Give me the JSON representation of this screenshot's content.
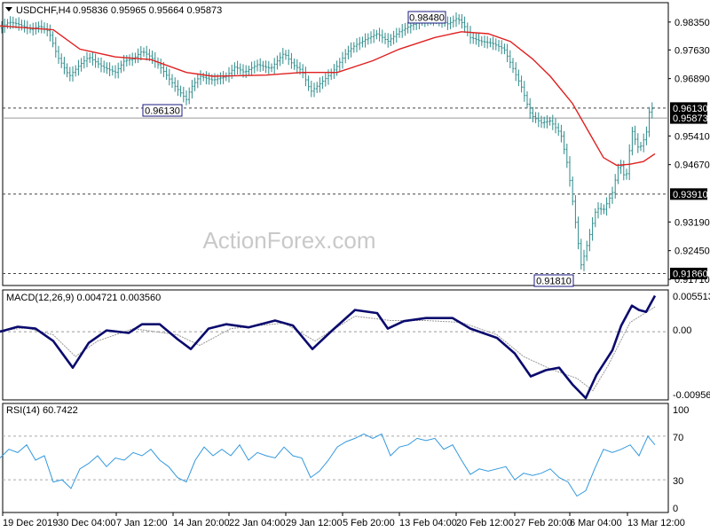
{
  "header": {
    "symbol": "USDCHF,H4",
    "ohlc": "0.95836 0.95965 0.95664 0.95873"
  },
  "watermark": "ActionForex.com",
  "price_panel": {
    "y_ticks": [
      "0.98350",
      "0.97630",
      "0.96890",
      "0.96130",
      "0.95873",
      "0.95410",
      "0.94670",
      "0.93910",
      "0.93190",
      "0.92450",
      "0.91860",
      "0.91710"
    ],
    "badge_ticks": [
      "0.96130",
      "0.95873",
      "0.93910",
      "0.91860"
    ],
    "callouts": [
      "0.98480",
      "0.96130",
      "0.91810"
    ]
  },
  "macd_panel": {
    "title": "MACD(12,26,9) 0.004721 0.003560",
    "y_ticks": [
      "0.005513",
      "0.00",
      "-0.009566"
    ]
  },
  "rsi_panel": {
    "title": "RSI(14) 60.7422",
    "y_ticks": [
      "100",
      "70",
      "30",
      "0"
    ]
  },
  "x_ticks": [
    "19 Dec 2019",
    "30 Dec 04:00",
    "7 Jan 12:00",
    "14 Jan 20:00",
    "22 Jan 04:00",
    "29 Jan 12:00",
    "5 Feb 20:00",
    "13 Feb 04:00",
    "20 Feb 12:00",
    "27 Feb 20:00",
    "6 Mar 04:00",
    "13 Mar 12:00"
  ],
  "colors": {
    "bars": "#2e8b8b",
    "ma": "#e02020",
    "macd": "#0a0a6e",
    "signal": "#999999",
    "rsi": "#3399dd",
    "badge": "#000000",
    "callout_border": "#1a1a80"
  },
  "chart_data": [
    {
      "type": "ohlc",
      "ylim": [
        0.9155,
        0.9885
      ],
      "horizontal_levels": [
        0.9613,
        0.95873,
        0.9391,
        0.9186
      ],
      "close_path": [
        [
          0,
          0.982
        ],
        [
          10,
          0.9835
        ],
        [
          20,
          0.983
        ],
        [
          35,
          0.9815
        ],
        [
          45,
          0.9825
        ],
        [
          55,
          0.981
        ],
        [
          65,
          0.9745
        ],
        [
          78,
          0.9695
        ],
        [
          90,
          0.9725
        ],
        [
          100,
          0.9745
        ],
        [
          115,
          0.972
        ],
        [
          130,
          0.9705
        ],
        [
          140,
          0.9735
        ],
        [
          150,
          0.974
        ],
        [
          160,
          0.976
        ],
        [
          170,
          0.9745
        ],
        [
          182,
          0.9715
        ],
        [
          195,
          0.9675
        ],
        [
          210,
          0.9635
        ],
        [
          215,
          0.9665
        ],
        [
          225,
          0.9695
        ],
        [
          240,
          0.9685
        ],
        [
          255,
          0.9695
        ],
        [
          265,
          0.972
        ],
        [
          275,
          0.9705
        ],
        [
          290,
          0.9725
        ],
        [
          305,
          0.9715
        ],
        [
          320,
          0.9755
        ],
        [
          330,
          0.9725
        ],
        [
          340,
          0.971
        ],
        [
          350,
          0.9655
        ],
        [
          365,
          0.9685
        ],
        [
          378,
          0.9715
        ],
        [
          390,
          0.9755
        ],
        [
          400,
          0.9775
        ],
        [
          412,
          0.979
        ],
        [
          425,
          0.9805
        ],
        [
          437,
          0.9785
        ],
        [
          450,
          0.981
        ],
        [
          462,
          0.9825
        ],
        [
          475,
          0.9838
        ],
        [
          490,
          0.9843
        ],
        [
          505,
          0.983
        ],
        [
          515,
          0.9845
        ],
        [
          522,
          0.983
        ],
        [
          530,
          0.9795
        ],
        [
          542,
          0.9785
        ],
        [
          555,
          0.978
        ],
        [
          568,
          0.9765
        ],
        [
          578,
          0.9715
        ],
        [
          588,
          0.9665
        ],
        [
          598,
          0.9595
        ],
        [
          610,
          0.9575
        ],
        [
          620,
          0.958
        ],
        [
          632,
          0.9545
        ],
        [
          640,
          0.946
        ],
        [
          648,
          0.9325
        ],
        [
          655,
          0.9205
        ],
        [
          662,
          0.9265
        ],
        [
          672,
          0.9355
        ],
        [
          680,
          0.935
        ],
        [
          690,
          0.9395
        ],
        [
          698,
          0.9475
        ],
        [
          705,
          0.9425
        ],
        [
          712,
          0.9555
        ],
        [
          720,
          0.9505
        ],
        [
          728,
          0.9545
        ],
        [
          733,
          0.9625
        ],
        [
          738,
          0.9587
        ]
      ],
      "ma_path": [
        [
          0,
          0.9825
        ],
        [
          60,
          0.9815
        ],
        [
          90,
          0.9765
        ],
        [
          130,
          0.9745
        ],
        [
          170,
          0.9738
        ],
        [
          210,
          0.9705
        ],
        [
          240,
          0.9695
        ],
        [
          300,
          0.9698
        ],
        [
          340,
          0.9705
        ],
        [
          380,
          0.9705
        ],
        [
          420,
          0.9735
        ],
        [
          450,
          0.9765
        ],
        [
          490,
          0.9795
        ],
        [
          520,
          0.981
        ],
        [
          550,
          0.9805
        ],
        [
          575,
          0.9785
        ],
        [
          600,
          0.974
        ],
        [
          620,
          0.9695
        ],
        [
          645,
          0.9625
        ],
        [
          665,
          0.9545
        ],
        [
          680,
          0.9485
        ],
        [
          695,
          0.9465
        ],
        [
          710,
          0.9468
        ],
        [
          725,
          0.9475
        ],
        [
          738,
          0.9495
        ]
      ]
    },
    {
      "type": "line",
      "ylim": [
        -0.0107,
        0.0063
      ],
      "macd_path": [
        [
          0,
          0.0
        ],
        [
          20,
          0.0008
        ],
        [
          40,
          0.0005
        ],
        [
          60,
          -0.0015
        ],
        [
          82,
          -0.0058
        ],
        [
          100,
          -0.0018
        ],
        [
          120,
          0.0002
        ],
        [
          145,
          -0.0002
        ],
        [
          160,
          0.0012
        ],
        [
          180,
          0.0012
        ],
        [
          200,
          -0.0012
        ],
        [
          215,
          -0.0028
        ],
        [
          235,
          0.0005
        ],
        [
          255,
          0.0012
        ],
        [
          280,
          0.0007
        ],
        [
          310,
          0.0018
        ],
        [
          330,
          0.001
        ],
        [
          352,
          -0.0028
        ],
        [
          375,
          0.0003
        ],
        [
          400,
          0.0035
        ],
        [
          425,
          0.003
        ],
        [
          437,
          0.0005
        ],
        [
          455,
          0.0017
        ],
        [
          480,
          0.0022
        ],
        [
          510,
          0.0022
        ],
        [
          530,
          0.0005
        ],
        [
          560,
          -0.001
        ],
        [
          580,
          -0.0035
        ],
        [
          598,
          -0.0072
        ],
        [
          615,
          -0.0062
        ],
        [
          630,
          -0.0058
        ],
        [
          645,
          -0.0085
        ],
        [
          660,
          -0.0107
        ],
        [
          672,
          -0.007
        ],
        [
          690,
          -0.003
        ],
        [
          700,
          0.001
        ],
        [
          712,
          0.0042
        ],
        [
          720,
          0.0035
        ],
        [
          728,
          0.0032
        ],
        [
          738,
          0.0058
        ]
      ],
      "signal_path": [
        [
          0,
          0.0002
        ],
        [
          30,
          0.0006
        ],
        [
          60,
          -0.0005
        ],
        [
          85,
          -0.004
        ],
        [
          110,
          -0.0015
        ],
        [
          150,
          0.0005
        ],
        [
          200,
          -0.0005
        ],
        [
          225,
          -0.0022
        ],
        [
          260,
          0.0005
        ],
        [
          320,
          0.0014
        ],
        [
          355,
          -0.0015
        ],
        [
          400,
          0.0025
        ],
        [
          440,
          0.0018
        ],
        [
          480,
          0.0018
        ],
        [
          520,
          0.0015
        ],
        [
          560,
          -0.0005
        ],
        [
          590,
          -0.004
        ],
        [
          620,
          -0.006
        ],
        [
          650,
          -0.0075
        ],
        [
          668,
          -0.0095
        ],
        [
          685,
          -0.0055
        ],
        [
          710,
          0.0015
        ],
        [
          738,
          0.004
        ]
      ]
    },
    {
      "type": "line",
      "ylim": [
        0,
        100
      ],
      "levels": [
        70,
        30
      ],
      "rsi_path": [
        [
          0,
          50
        ],
        [
          10,
          58
        ],
        [
          20,
          55
        ],
        [
          30,
          62
        ],
        [
          40,
          48
        ],
        [
          50,
          52
        ],
        [
          60,
          28
        ],
        [
          70,
          30
        ],
        [
          80,
          22
        ],
        [
          90,
          40
        ],
        [
          100,
          45
        ],
        [
          110,
          52
        ],
        [
          120,
          42
        ],
        [
          130,
          50
        ],
        [
          140,
          48
        ],
        [
          150,
          55
        ],
        [
          160,
          52
        ],
        [
          170,
          58
        ],
        [
          180,
          48
        ],
        [
          190,
          42
        ],
        [
          200,
          32
        ],
        [
          210,
          28
        ],
        [
          220,
          48
        ],
        [
          230,
          60
        ],
        [
          240,
          52
        ],
        [
          250,
          58
        ],
        [
          260,
          52
        ],
        [
          270,
          62
        ],
        [
          280,
          48
        ],
        [
          290,
          55
        ],
        [
          300,
          52
        ],
        [
          310,
          50
        ],
        [
          320,
          60
        ],
        [
          330,
          52
        ],
        [
          340,
          50
        ],
        [
          350,
          32
        ],
        [
          360,
          38
        ],
        [
          370,
          48
        ],
        [
          380,
          60
        ],
        [
          390,
          65
        ],
        [
          400,
          68
        ],
        [
          410,
          72
        ],
        [
          420,
          68
        ],
        [
          430,
          72
        ],
        [
          440,
          52
        ],
        [
          450,
          60
        ],
        [
          460,
          62
        ],
        [
          470,
          68
        ],
        [
          480,
          66
        ],
        [
          490,
          68
        ],
        [
          500,
          58
        ],
        [
          510,
          62
        ],
        [
          520,
          48
        ],
        [
          530,
          35
        ],
        [
          540,
          40
        ],
        [
          550,
          38
        ],
        [
          560,
          40
        ],
        [
          570,
          42
        ],
        [
          580,
          30
        ],
        [
          590,
          36
        ],
        [
          600,
          34
        ],
        [
          610,
          36
        ],
        [
          620,
          40
        ],
        [
          630,
          32
        ],
        [
          640,
          28
        ],
        [
          650,
          15
        ],
        [
          660,
          20
        ],
        [
          670,
          40
        ],
        [
          680,
          58
        ],
        [
          690,
          55
        ],
        [
          700,
          58
        ],
        [
          710,
          62
        ],
        [
          720,
          52
        ],
        [
          730,
          70
        ],
        [
          738,
          62
        ]
      ]
    }
  ]
}
